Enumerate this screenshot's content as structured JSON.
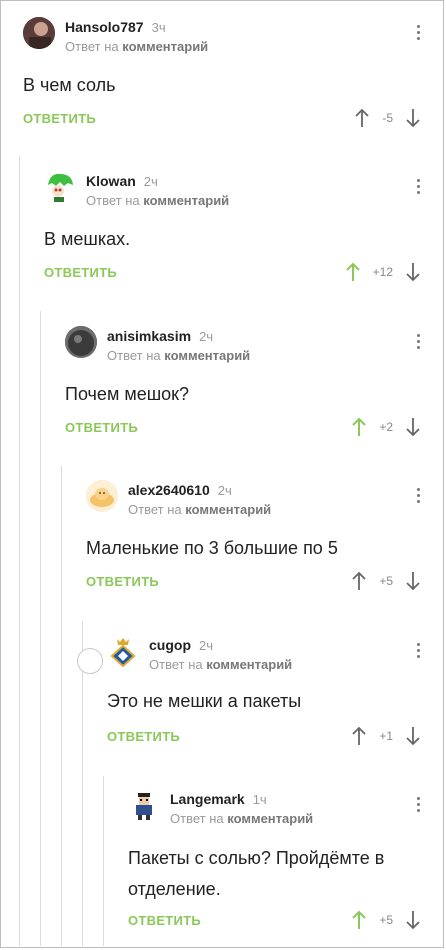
{
  "reply_prefix": "Ответ на",
  "reply_target": "комментарий",
  "reply_label": "ОТВЕТИТЬ",
  "comments": [
    {
      "username": "Hansolo787",
      "time": "3ч",
      "text": "В чем соль",
      "rating": "-5",
      "upvoted": false
    },
    {
      "username": "Klowan",
      "time": "2ч",
      "text": "В мешках.",
      "rating": "+12",
      "upvoted": true
    },
    {
      "username": "anisimkasim",
      "time": "2ч",
      "text": "Почем мешок?",
      "rating": "+2",
      "upvoted": true
    },
    {
      "username": "alex2640610",
      "time": "2ч",
      "text": "Маленькие по 3 большие по 5",
      "rating": "+5",
      "upvoted": false
    },
    {
      "username": "cugop",
      "time": "2ч",
      "text": "Это не мешки а пакеты",
      "rating": "+1",
      "upvoted": false
    },
    {
      "username": "Langemark",
      "time": "1ч",
      "text": "Пакеты с солью? Пройдёмте в отделение.",
      "rating": "+5",
      "upvoted": true
    }
  ],
  "colors": {
    "accent": "#8ac858",
    "muted": "#9a9a9a",
    "text": "#222222"
  },
  "icons": [
    "menu-dots-icon",
    "upvote-arrow-icon",
    "downvote-arrow-icon"
  ]
}
